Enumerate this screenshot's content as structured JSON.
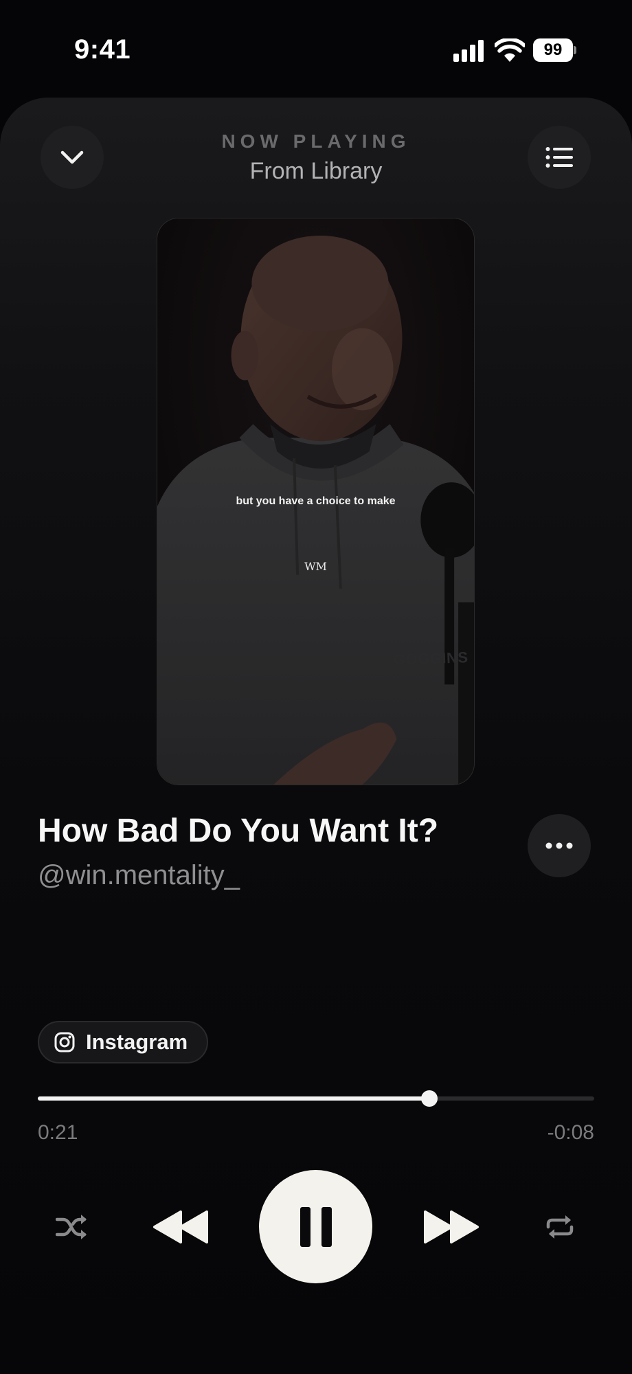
{
  "status_bar": {
    "time": "9:41",
    "battery_level": "99",
    "icons": [
      "signal-icon",
      "wifi-icon",
      "battery-icon"
    ]
  },
  "header": {
    "label": "NOW PLAYING",
    "source": "From Library",
    "left_icon": "chevron-down-icon",
    "right_icon": "queue-list-icon"
  },
  "artwork": {
    "caption": "but you have a choice to make",
    "watermark": "WM",
    "hoodie_text": "GOGGINS"
  },
  "track": {
    "title": "How Bad Do You Want It?",
    "artist": "@win.mentality_",
    "more_icon": "ellipsis-icon"
  },
  "source_chip": {
    "label": "Instagram",
    "icon": "instagram-icon"
  },
  "playback": {
    "elapsed": "0:21",
    "remaining": "-0:08",
    "progress_fraction": 0.704,
    "state": "playing"
  },
  "controls": [
    "shuffle-icon",
    "rewind-icon",
    "pause-icon",
    "fast-forward-icon",
    "repeat-icon"
  ],
  "colors": {
    "background": "#050507",
    "accent": "#f4f2ec",
    "muted_text": "#8f8f91"
  }
}
